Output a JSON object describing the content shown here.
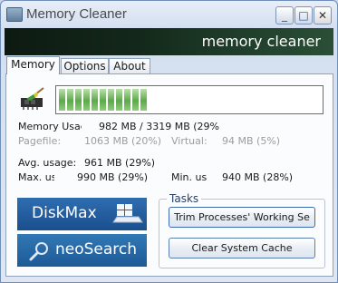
{
  "window": {
    "title": "Memory Cleaner",
    "minimize_glyph": "_",
    "maximize_glyph": "□",
    "close_glyph": "✕"
  },
  "banner": {
    "text": "memory cleaner"
  },
  "tabs": [
    {
      "label": "Memory",
      "selected": true
    },
    {
      "label": "Options",
      "selected": false
    },
    {
      "label": "About",
      "selected": false
    }
  ],
  "memory": {
    "usage_fraction": 0.29,
    "rows": [
      {
        "label": "Memory Usage:",
        "value": "982 MB / 3319 MB  (29%"
      },
      {
        "label": "Pagefile:",
        "value": "1063 MB (20%)"
      },
      {
        "label": "Virtual:",
        "value": "94 MB (5%)"
      },
      {
        "label": "Avg. usage:",
        "value": "961 MB (29%)"
      },
      {
        "label": "Max. usage:",
        "value": "990 MB (29%)"
      },
      {
        "label": "Min. usage:",
        "value": "940 MB (28%)"
      }
    ]
  },
  "ads": [
    {
      "label": "DiskMax"
    },
    {
      "label": "neoSearch"
    }
  ],
  "tasks": {
    "legend": "Tasks",
    "trim_label": "Trim Processes' Working Se",
    "clear_label": "Clear System Cache"
  },
  "colors": {
    "meter_fill": "#6fb35a",
    "banner": "#13281a",
    "ad": "#2a64a8"
  }
}
